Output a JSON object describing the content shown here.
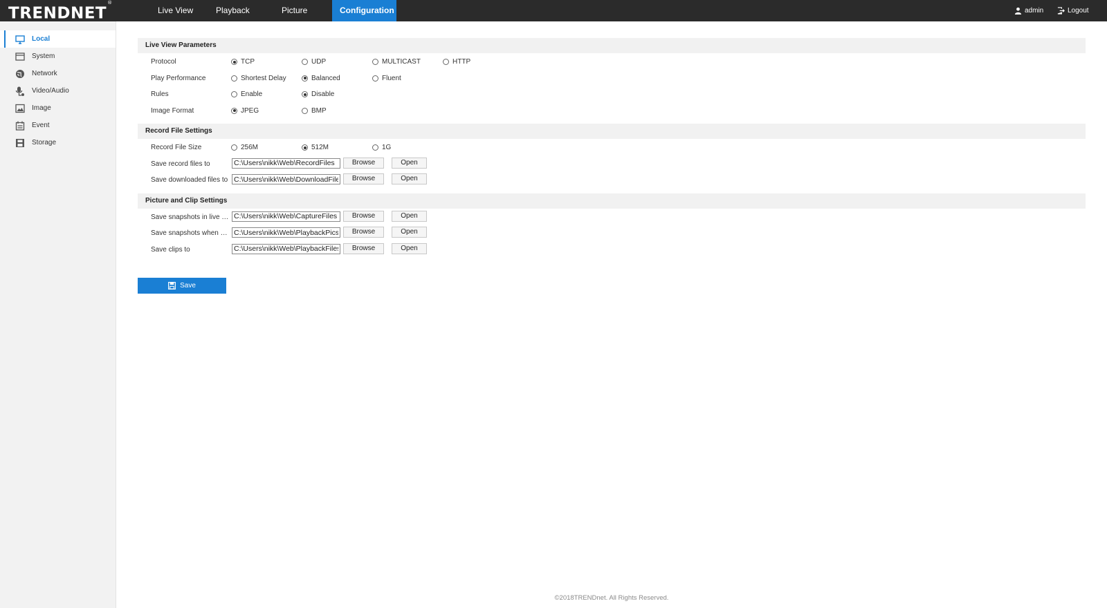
{
  "brand": {
    "logo_text": "TRENDNET",
    "logo_mark": "®"
  },
  "nav": {
    "items": [
      {
        "label": "Live View"
      },
      {
        "label": "Playback"
      },
      {
        "label": "Picture"
      },
      {
        "label": "Configuration"
      }
    ],
    "active": "Configuration"
  },
  "user": {
    "name": "admin",
    "logout_label": "Logout"
  },
  "sidebar": {
    "items": [
      {
        "label": "Local",
        "icon": "monitor-icon"
      },
      {
        "label": "System",
        "icon": "system-icon"
      },
      {
        "label": "Network",
        "icon": "globe-icon"
      },
      {
        "label": "Video/Audio",
        "icon": "microphone-icon"
      },
      {
        "label": "Image",
        "icon": "image-icon"
      },
      {
        "label": "Event",
        "icon": "calendar-icon"
      },
      {
        "label": "Storage",
        "icon": "storage-icon"
      }
    ],
    "active": "Local"
  },
  "live_view": {
    "title": "Live View Parameters",
    "protocol": {
      "label": "Protocol",
      "options": [
        "TCP",
        "UDP",
        "MULTICAST",
        "HTTP"
      ],
      "selected": "TCP"
    },
    "play_performance": {
      "label": "Play Performance",
      "options": [
        "Shortest Delay",
        "Balanced",
        "Fluent"
      ],
      "selected": "Balanced"
    },
    "rules": {
      "label": "Rules",
      "options": [
        "Enable",
        "Disable"
      ],
      "selected": "Disable"
    },
    "image_format": {
      "label": "Image Format",
      "options": [
        "JPEG",
        "BMP"
      ],
      "selected": "JPEG"
    }
  },
  "record_file": {
    "title": "Record File Settings",
    "size": {
      "label": "Record File Size",
      "options": [
        "256M",
        "512M",
        "1G"
      ],
      "selected": "512M"
    },
    "save_record": {
      "label": "Save record files to",
      "value": "C:\\Users\\nikk\\Web\\RecordFiles"
    },
    "save_downloaded": {
      "label": "Save downloaded files to",
      "value": "C:\\Users\\nikk\\Web\\DownloadFiles"
    }
  },
  "picture_clip": {
    "title": "Picture and Clip Settings",
    "snap_live": {
      "label": "Save snapshots in live vi...",
      "value": "C:\\Users\\nikk\\Web\\CaptureFiles"
    },
    "snap_playback": {
      "label": "Save snapshots when pla...",
      "value": "C:\\Users\\nikk\\Web\\PlaybackPics"
    },
    "clips": {
      "label": "Save clips to",
      "value": "C:\\Users\\nikk\\Web\\PlaybackFiles"
    }
  },
  "buttons": {
    "browse": "Browse",
    "open": "Open",
    "save": "Save"
  },
  "footer": {
    "copyright": "©2018TRENDnet. All Rights Reserved."
  },
  "colors": {
    "accent": "#1a7fd4",
    "topbar": "#2b2b2b",
    "sidebar": "#f2f2f2"
  }
}
